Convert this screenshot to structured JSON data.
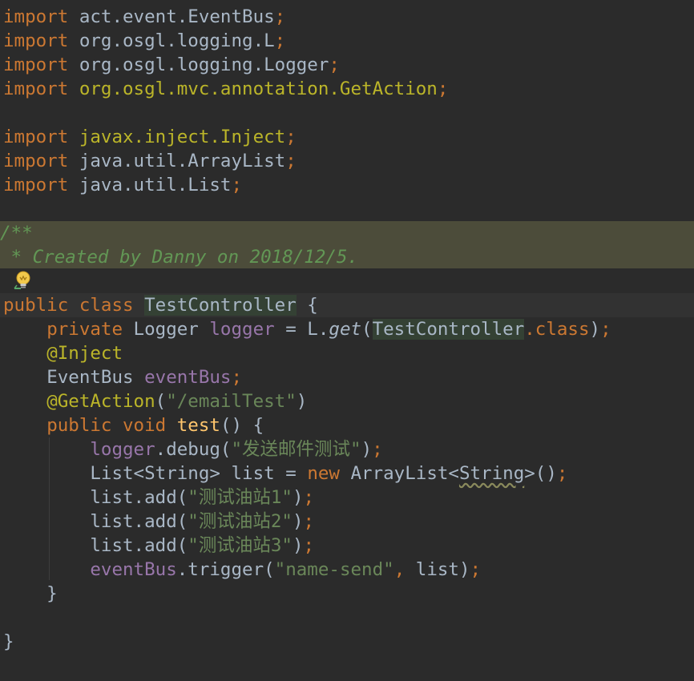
{
  "lines": {
    "l1": {
      "kw": "import",
      "rest": " act.event.EventBus",
      "semi": ";"
    },
    "l2": {
      "kw": "import",
      "rest": " org.osgl.logging.L",
      "semi": ";"
    },
    "l3": {
      "kw": "import",
      "rest": " org.osgl.logging.Logger",
      "semi": ";"
    },
    "l4": {
      "kw": "import",
      "space": " ",
      "pkg": "org.osgl.mvc.annotation.GetAction",
      "semi": ";"
    },
    "l6": {
      "kw": "import",
      "space": " ",
      "pkg": "javax.inject.Inject",
      "semi": ";"
    },
    "l7": {
      "kw": "import",
      "rest": " java.util.ArrayList",
      "semi": ";"
    },
    "l8": {
      "kw": "import",
      "rest": " java.util.List",
      "semi": ";"
    },
    "l10": {
      "doc": "/**"
    },
    "l11": {
      "doc": " * Created by Danny on 2018/12/5."
    },
    "l13": {
      "kw": "public class ",
      "name": "TestController",
      "rest": " {"
    },
    "l14": {
      "indent": "    ",
      "kw": "private",
      "type": " Logger ",
      "field": "logger",
      "eq": " = L.",
      "method": "get",
      "open": "(",
      "cls": "TestController",
      "dot": ".",
      "kw2": "class",
      "close": ")",
      "semi": ";"
    },
    "l15": {
      "indent": "    ",
      "ann": "@Inject"
    },
    "l16": {
      "indent": "    ",
      "type": "EventBus ",
      "field": "eventBus",
      "semi": ";"
    },
    "l17": {
      "indent": "    ",
      "ann": "@GetAction",
      "open": "(",
      "str": "\"/emailTest\"",
      "close": ")"
    },
    "l18": {
      "indent": "    ",
      "kw": "public void ",
      "fn": "test",
      "rest": "() {"
    },
    "l19": {
      "indent": "        ",
      "field": "logger",
      "call": ".debug(",
      "str": "\"发送邮件测试\"",
      "close": ")",
      "semi": ";"
    },
    "l20": {
      "indent": "        ",
      "pre": "List<String> list = ",
      "kw": "new",
      "mid": " ArrayList<",
      "warn": "String",
      "post": ">()",
      "semi": ";"
    },
    "l21": {
      "indent": "        ",
      "call": "list.add(",
      "str": "\"测试油站1\"",
      "close": ")",
      "semi": ";"
    },
    "l22": {
      "indent": "        ",
      "call": "list.add(",
      "str": "\"测试油站2\"",
      "close": ")",
      "semi": ";"
    },
    "l23": {
      "indent": "        ",
      "call": "list.add(",
      "str": "\"测试油站3\"",
      "close": ")",
      "semi": ";"
    },
    "l24": {
      "indent": "        ",
      "field": "eventBus",
      "call": ".trigger(",
      "str": "\"name-send\"",
      "comma": ",",
      "rest": " list)",
      "semi": ";"
    },
    "l25": {
      "text": "    }"
    },
    "l27": {
      "text": "}"
    }
  },
  "icons": {
    "intention_bulb": "lightbulb-icon"
  },
  "colors": {
    "background": "#2b2b2b",
    "keyword": "#cc7832",
    "annotation": "#bbb529",
    "string": "#6a8759",
    "field": "#9876aa",
    "doc_comment": "#629755",
    "method_decl": "#ffc66d",
    "default_text": "#a9b7c6"
  }
}
